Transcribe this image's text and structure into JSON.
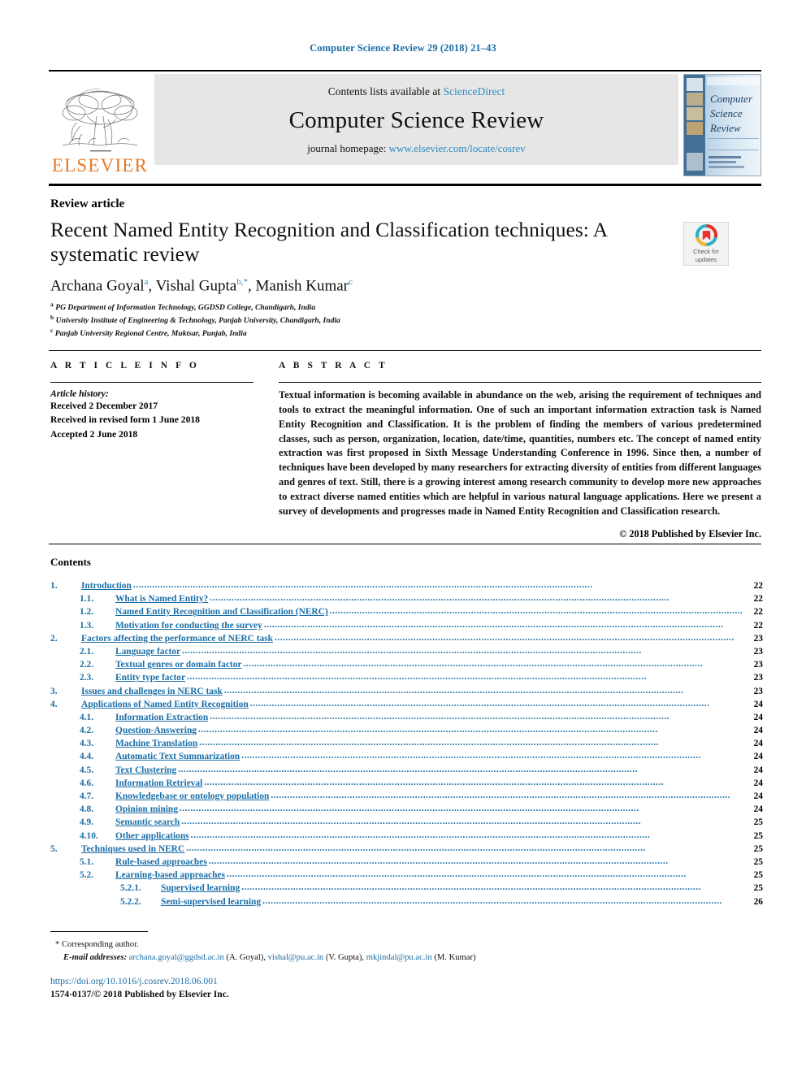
{
  "running_head": "Computer Science Review 29 (2018) 21–43",
  "masthead": {
    "publisher_name": "ELSEVIER",
    "contents_prefix": "Contents lists available at ",
    "sciencedirect": "ScienceDirect",
    "journal_name": "Computer Science Review",
    "homepage_prefix": "journal homepage: ",
    "homepage_url": "www.elsevier.com/locate/cosrev",
    "cover_title_lines": [
      "Computer",
      "Science",
      "Review"
    ]
  },
  "crossmark": {
    "line1": "Check for",
    "line2": "updates"
  },
  "article": {
    "type": "Review article",
    "title": "Recent Named Entity Recognition and Classification techniques: A systematic review",
    "authors_plain": "Archana Goyal a, Vishal Gupta b,*, Manish Kumar c",
    "authors": [
      {
        "name": "Archana Goyal",
        "marks": "a"
      },
      {
        "name": "Vishal Gupta",
        "marks": "b,*"
      },
      {
        "name": "Manish Kumar",
        "marks": "c"
      }
    ],
    "affiliations": [
      {
        "mark": "a",
        "text": "PG Department of Information Technology, GGDSD College, Chandigarh, India"
      },
      {
        "mark": "b",
        "text": "University Institute of Engineering & Technology, Panjab University, Chandigarh, India"
      },
      {
        "mark": "c",
        "text": "Panjab University Regional Centre, Muktsar, Punjab, India"
      }
    ]
  },
  "info": {
    "heading": "A R T I C L E   I N F O",
    "history_label": "Article history:",
    "history": [
      "Received 2 December 2017",
      "Received in revised form 1 June 2018",
      "Accepted 2 June 2018"
    ]
  },
  "abstract": {
    "heading": "A B S T R A C T",
    "body": "Textual information is becoming available in abundance on the web, arising the requirement of techniques and tools to extract the meaningful information. One of such an important information extraction task is Named Entity Recognition and Classification. It is the problem of finding the members of various predetermined classes, such as person, organization, location, date/time, quantities, numbers etc. The concept of named entity extraction was first proposed in Sixth Message Understanding Conference in 1996. Since then, a number of techniques have been developed by many researchers for extracting diversity of entities from different languages and genres of text. Still, there is a growing interest among research community to develop more new approaches to extract diverse named entities which are helpful in various natural language applications. Here we present a survey of developments and progresses made in Named Entity Recognition and Classification research.",
    "copyright": "© 2018 Published by Elsevier Inc."
  },
  "contents": {
    "title": "Contents",
    "entries": [
      {
        "level": 1,
        "num": "1.",
        "label": "Introduction",
        "page": "22"
      },
      {
        "level": 2,
        "num": "1.1.",
        "label": "What is Named Entity?",
        "page": "22"
      },
      {
        "level": 2,
        "num": "1.2.",
        "label": "Named Entity Recognition and Classification (NERC)",
        "page": "22"
      },
      {
        "level": 2,
        "num": "1.3.",
        "label": "Motivation for conducting the survey",
        "page": "22"
      },
      {
        "level": 1,
        "num": "2.",
        "label": "Factors affecting the performance of NERC task",
        "page": "23"
      },
      {
        "level": 2,
        "num": "2.1.",
        "label": "Language factor",
        "page": "23"
      },
      {
        "level": 2,
        "num": "2.2.",
        "label": "Textual genres or domain factor",
        "page": "23"
      },
      {
        "level": 2,
        "num": "2.3.",
        "label": "Entity type factor",
        "page": "23"
      },
      {
        "level": 1,
        "num": "3.",
        "label": "Issues and challenges in NERC task",
        "page": "23"
      },
      {
        "level": 1,
        "num": "4.",
        "label": "Applications of Named Entity Recognition",
        "page": "24"
      },
      {
        "level": 2,
        "num": "4.1.",
        "label": "Information Extraction",
        "page": "24"
      },
      {
        "level": 2,
        "num": "4.2.",
        "label": "Question-Answering",
        "page": "24"
      },
      {
        "level": 2,
        "num": "4.3.",
        "label": "Machine Translation",
        "page": "24"
      },
      {
        "level": 2,
        "num": "4.4.",
        "label": "Automatic Text Summarization",
        "page": "24"
      },
      {
        "level": 2,
        "num": "4.5.",
        "label": "Text Clustering",
        "page": "24"
      },
      {
        "level": 2,
        "num": "4.6.",
        "label": "Information Retrieval",
        "page": "24"
      },
      {
        "level": 2,
        "num": "4.7.",
        "label": "Knowledgebase or ontology population",
        "page": "24"
      },
      {
        "level": 2,
        "num": "4.8.",
        "label": "Opinion mining",
        "page": "24"
      },
      {
        "level": 2,
        "num": "4.9.",
        "label": "Semantic search",
        "page": "25"
      },
      {
        "level": 2,
        "num": "4.10.",
        "label": "Other applications",
        "page": "25"
      },
      {
        "level": 1,
        "num": "5.",
        "label": "Techniques used in NERC",
        "page": "25"
      },
      {
        "level": 2,
        "num": "5.1.",
        "label": "Rule-based approaches",
        "page": "25"
      },
      {
        "level": 2,
        "num": "5.2.",
        "label": "Learning-based approaches",
        "page": "25"
      },
      {
        "level": 3,
        "num": "5.2.1.",
        "label": "Supervised learning",
        "page": "25"
      },
      {
        "level": 3,
        "num": "5.2.2.",
        "label": "Semi-supervised learning",
        "page": "26"
      }
    ]
  },
  "footnotes": {
    "corresponding": "Corresponding author.",
    "email_label": "E-mail addresses:",
    "emails": [
      {
        "address": "archana.goyal@ggdsd.ac.in",
        "person": "(A. Goyal)"
      },
      {
        "address": "vishal@pu.ac.in",
        "person": "(V. Gupta)"
      },
      {
        "address": "mkjindal@pu.ac.in",
        "person": "(M. Kumar)"
      }
    ],
    "doi": "https://doi.org/10.1016/j.cosrev.2018.06.001",
    "issn_line": "1574-0137/© 2018 Published by Elsevier Inc."
  },
  "colors": {
    "link_blue": "#1a6ea8",
    "sd_blue": "#2e8bc0",
    "elsevier_orange": "#e87722"
  }
}
